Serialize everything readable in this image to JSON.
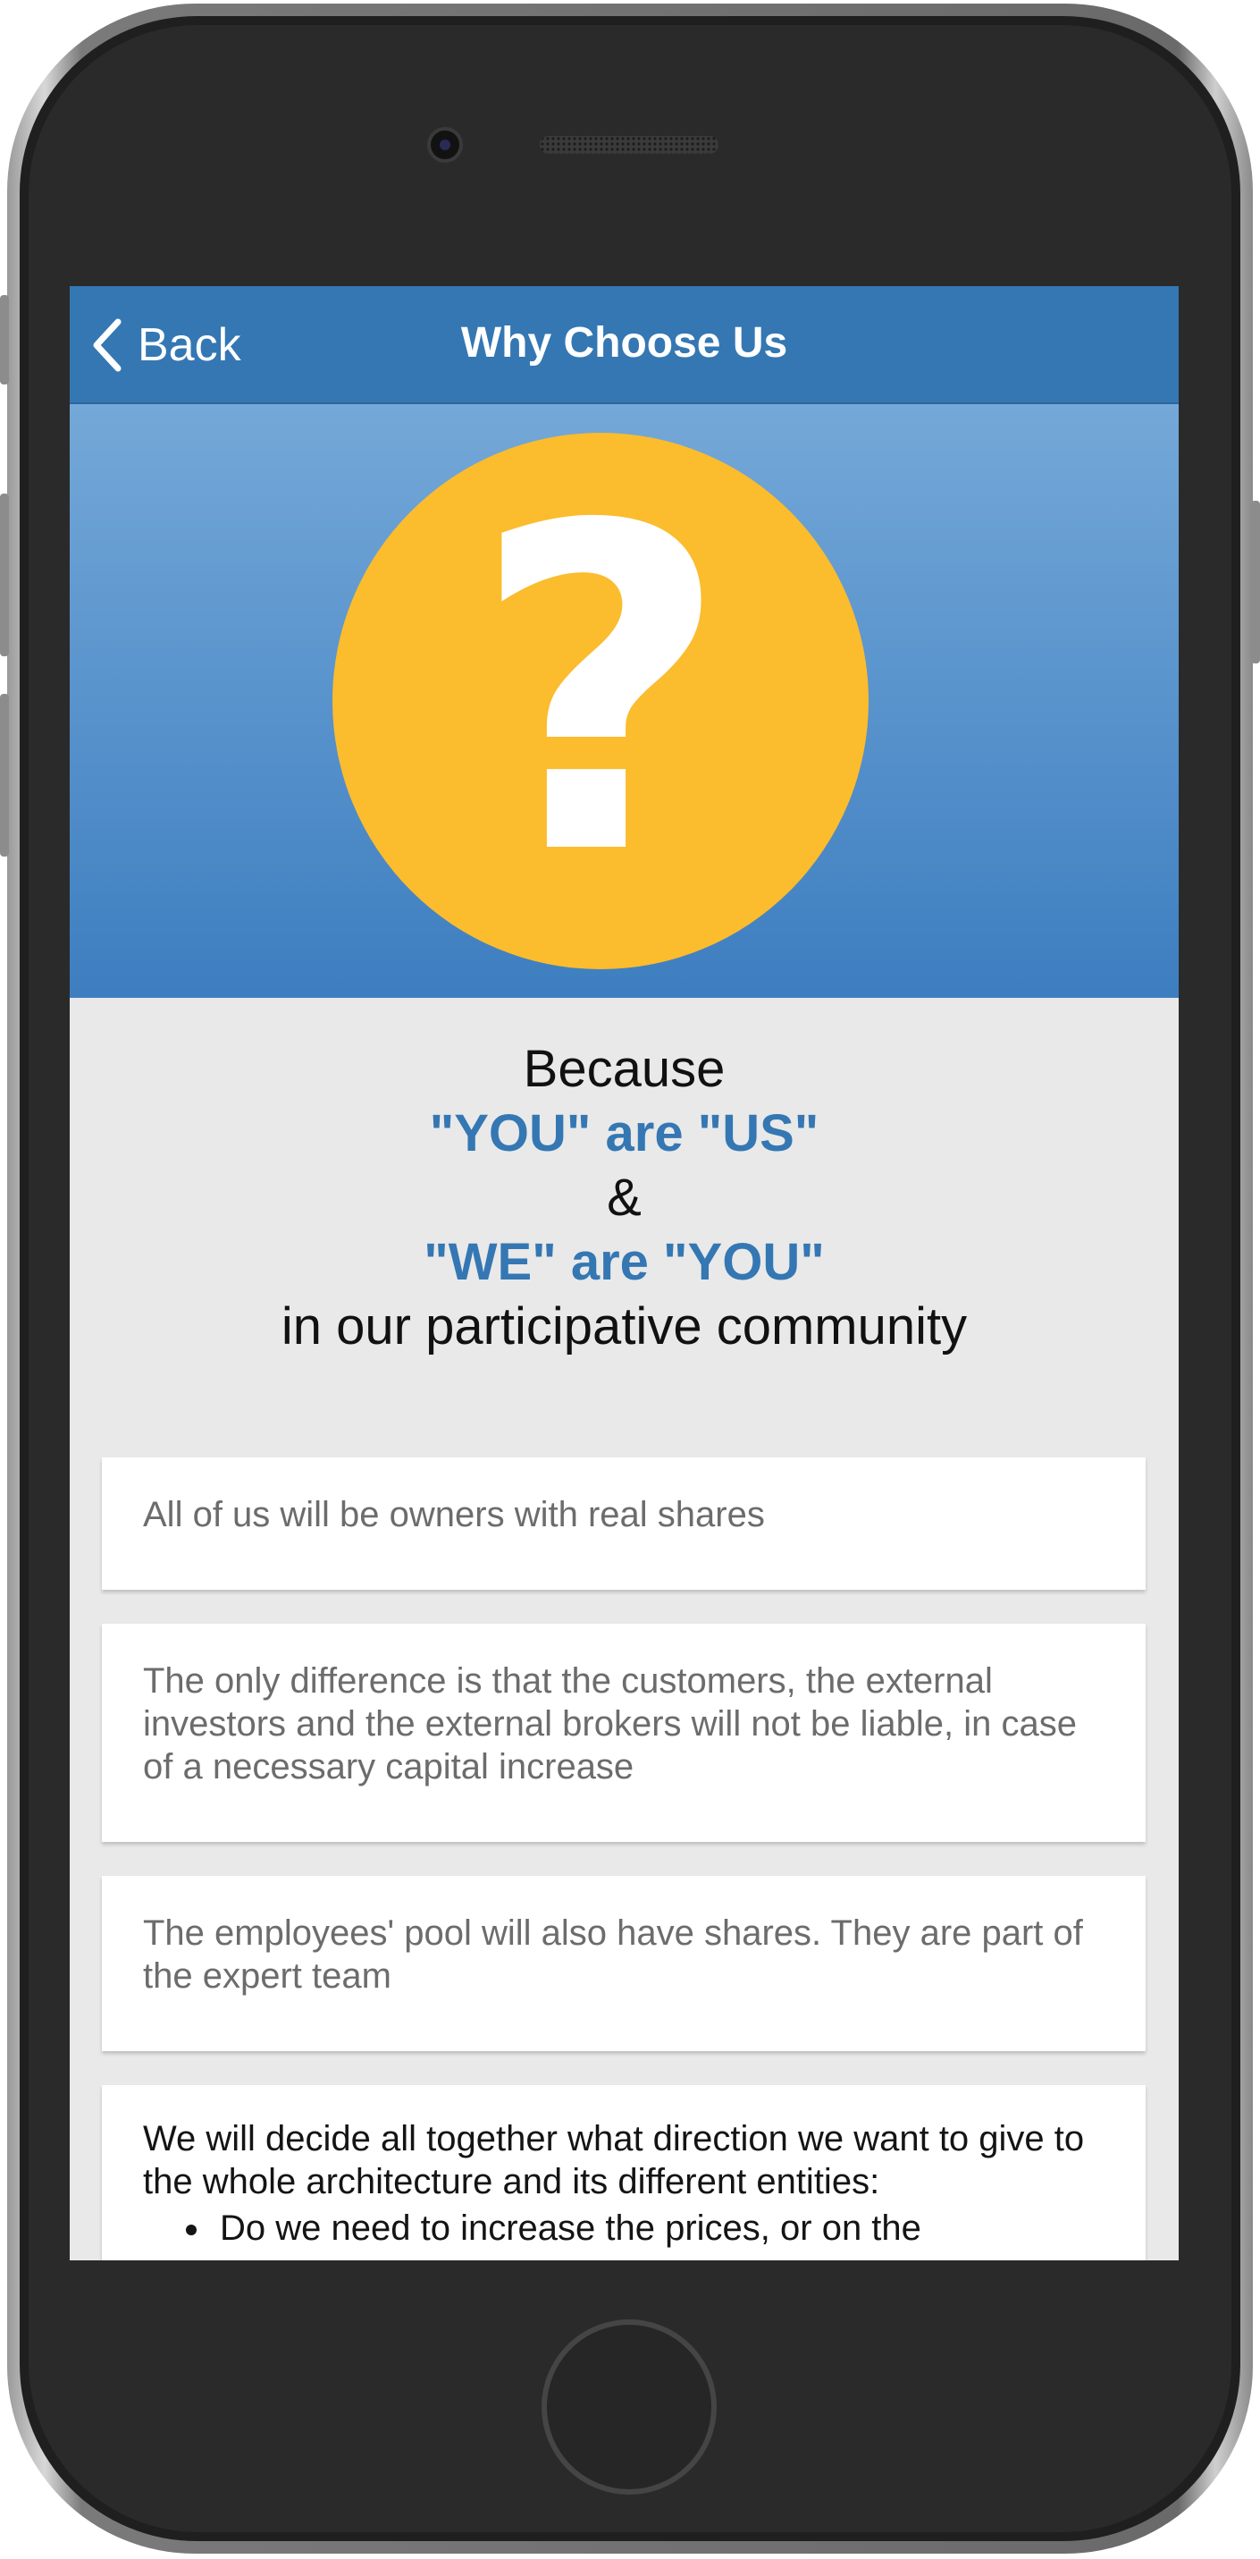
{
  "nav": {
    "back_label": "Back",
    "title": "Why Choose Us"
  },
  "hero": {
    "icon": "question-mark-icon",
    "glyph": "?",
    "circle_color": "#fbbc2e"
  },
  "motto": {
    "line1": "Because",
    "line2": "\"YOU\" are \"US\"",
    "line3": "&",
    "line4": "\"WE\" are \"YOU\"",
    "line5": "in our participative community"
  },
  "cards": [
    {
      "text": "All of us will be owners with real shares"
    },
    {
      "text": "The only difference is that the customers, the external investors and the external brokers will not be liable, in case of a necessary capital increase"
    },
    {
      "text": "The employees' pool will also have shares. They are part of the expert team"
    },
    {
      "text": "We will decide all together what direction we want to give to the whole architecture and its different entities:",
      "bullets": [
        "Do we need to increase the prices, or on the"
      ]
    }
  ],
  "colors": {
    "nav_bar": "#3477b3",
    "accent_text": "#3477b3",
    "background": "#e9e9e9"
  }
}
